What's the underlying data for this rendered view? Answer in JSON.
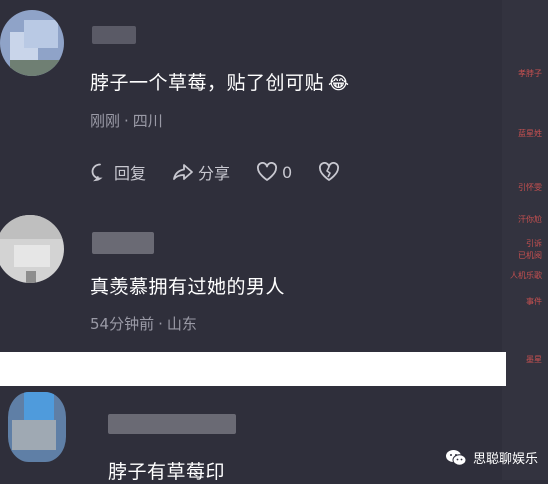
{
  "comments": [
    {
      "text": "脖子一个草莓，贴了创可贴",
      "emoji": "😂",
      "time": "刚刚",
      "location": "四川"
    },
    {
      "text": "真羡慕拥有过她的男人",
      "time": "54分钟前",
      "location": "山东"
    },
    {
      "text": "脖子有草莓印"
    }
  ],
  "actions": {
    "reply_label": "回复",
    "share_label": "分享",
    "like_count": "0"
  },
  "meta_separator": "·",
  "side_fragments": [
    "孝脖子",
    "蓝星姓",
    "引怀雯",
    "汗你尬",
    "引诉",
    "已机阅",
    "人机乐歌",
    "事件",
    "墨星"
  ],
  "watermark": {
    "label": "思聪聊娱乐",
    "icon": "wechat-icon"
  },
  "colors": {
    "background": "#2f2f3b",
    "meta_text": "#9a9aa6",
    "band": "#ffffff"
  }
}
